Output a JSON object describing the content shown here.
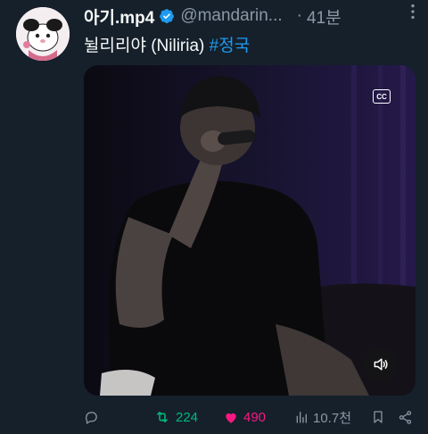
{
  "tweet": {
    "author_name": "아기.mp4",
    "handle": "@mandarin...",
    "separator": "·",
    "time": "41분",
    "text_main": "뉠리리야 (Niliria)",
    "hashtag": "#정국"
  },
  "media": {
    "cc_label": "CC"
  },
  "actions": {
    "retweets": "224",
    "likes": "490",
    "views": "10.7천"
  },
  "colors": {
    "background": "#15202b",
    "accent_blue": "#1d9bf0",
    "retweet_green": "#00ba7c",
    "like_pink": "#f91880",
    "muted": "#8b98a5"
  },
  "icons": [
    "verified-badge-icon",
    "more-icon",
    "cc-icon",
    "sound-icon",
    "reply-icon",
    "retweet-icon",
    "like-icon",
    "views-icon",
    "bookmark-icon",
    "share-icon"
  ]
}
